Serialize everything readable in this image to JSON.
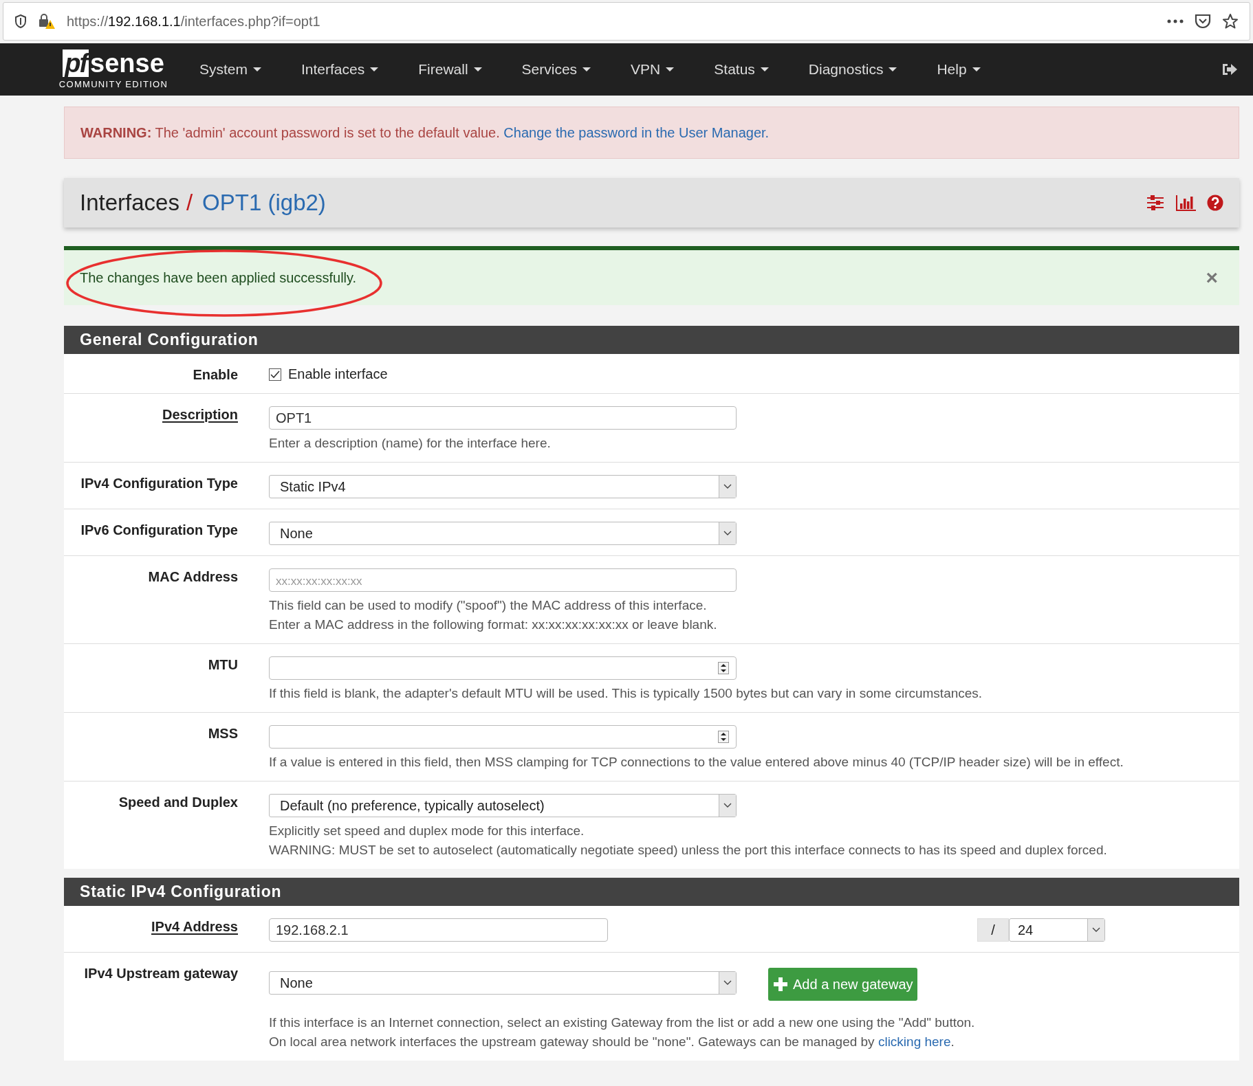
{
  "browser": {
    "url_scheme": "https://",
    "url_host": "192.168.1.1",
    "url_path": "/interfaces.php?if=opt1"
  },
  "navbar": {
    "logo": {
      "mark": "pf",
      "word": "sense",
      "edition": "COMMUNITY EDITION"
    },
    "menu": [
      {
        "label": "System"
      },
      {
        "label": "Interfaces"
      },
      {
        "label": "Firewall"
      },
      {
        "label": "Services"
      },
      {
        "label": "VPN"
      },
      {
        "label": "Status"
      },
      {
        "label": "Diagnostics"
      },
      {
        "label": "Help"
      }
    ]
  },
  "warning": {
    "text": "**WARNING:** The 'admin' account password is set to the default value.",
    "link": "Change the password in the User Manager."
  },
  "breadcrumb": {
    "parent": "Interfaces",
    "separator": "/",
    "current": "OPT1 (igb2)"
  },
  "alert": {
    "message": "The changes have been applied successfully.",
    "close": "×",
    "highlighted": true
  },
  "sections": [
    {
      "title": "General Configuration",
      "rows": [
        {
          "kind": "checkbox",
          "label": "Enable",
          "checked": true,
          "option": "Enable interface"
        },
        {
          "kind": "text",
          "label": "Description",
          "linked": true,
          "value": "OPT1",
          "help": [
            {
              "text": "Enter a description (name) for the interface here."
            }
          ]
        },
        {
          "kind": "select",
          "label": "IPv4 Configuration Type",
          "value": "Static IPv4"
        },
        {
          "kind": "select",
          "label": "IPv6 Configuration Type",
          "value": "None"
        },
        {
          "kind": "text",
          "label": "MAC Address",
          "placeholder": "xx:xx:xx:xx:xx:xx",
          "help": [
            {
              "text": "This field can be used to modify (\"spoof\") the MAC address of this interface."
            },
            {
              "text": "Enter a MAC address in the following format: xx:xx:xx:xx:xx:xx or leave blank."
            }
          ]
        },
        {
          "kind": "number",
          "label": "MTU",
          "help": [
            {
              "text": "If this field is blank, the adapter's default MTU will be used. This is typically 1500 bytes but can vary in some circumstances."
            }
          ]
        },
        {
          "kind": "number",
          "label": "MSS",
          "help": [
            {
              "text": "If a value is entered in this field, then MSS clamping for TCP connections to the value entered above minus 40 (TCP/IP header size) will be in effect."
            }
          ]
        },
        {
          "kind": "select",
          "label": "Speed and Duplex",
          "value": "Default (no preference, typically autoselect)",
          "help": [
            {
              "text": "Explicitly set speed and duplex mode for this interface."
            },
            {
              "text": "WARNING: MUST be set to autoselect (automatically negotiate speed) unless the port this interface connects to has its speed and duplex forced."
            }
          ]
        }
      ]
    },
    {
      "title": "Static IPv4 Configuration",
      "rows": [
        {
          "kind": "cidr",
          "label": "IPv4 Address",
          "linked": true,
          "value": "192.168.2.1",
          "separator": "/",
          "mask": "24"
        },
        {
          "kind": "gateway",
          "label": "IPv4 Upstream gateway",
          "value": "None",
          "button": "Add a new gateway",
          "help": [
            {
              "text": "If this interface is an Internet connection, select an existing Gateway from the list or add a new one using the \"Add\" button."
            },
            {
              "text": "On local area network interfaces the upstream gateway should be \"none\". Gateways can be managed by ",
              "link": "clicking here",
              "tail": "."
            }
          ]
        }
      ]
    }
  ]
}
